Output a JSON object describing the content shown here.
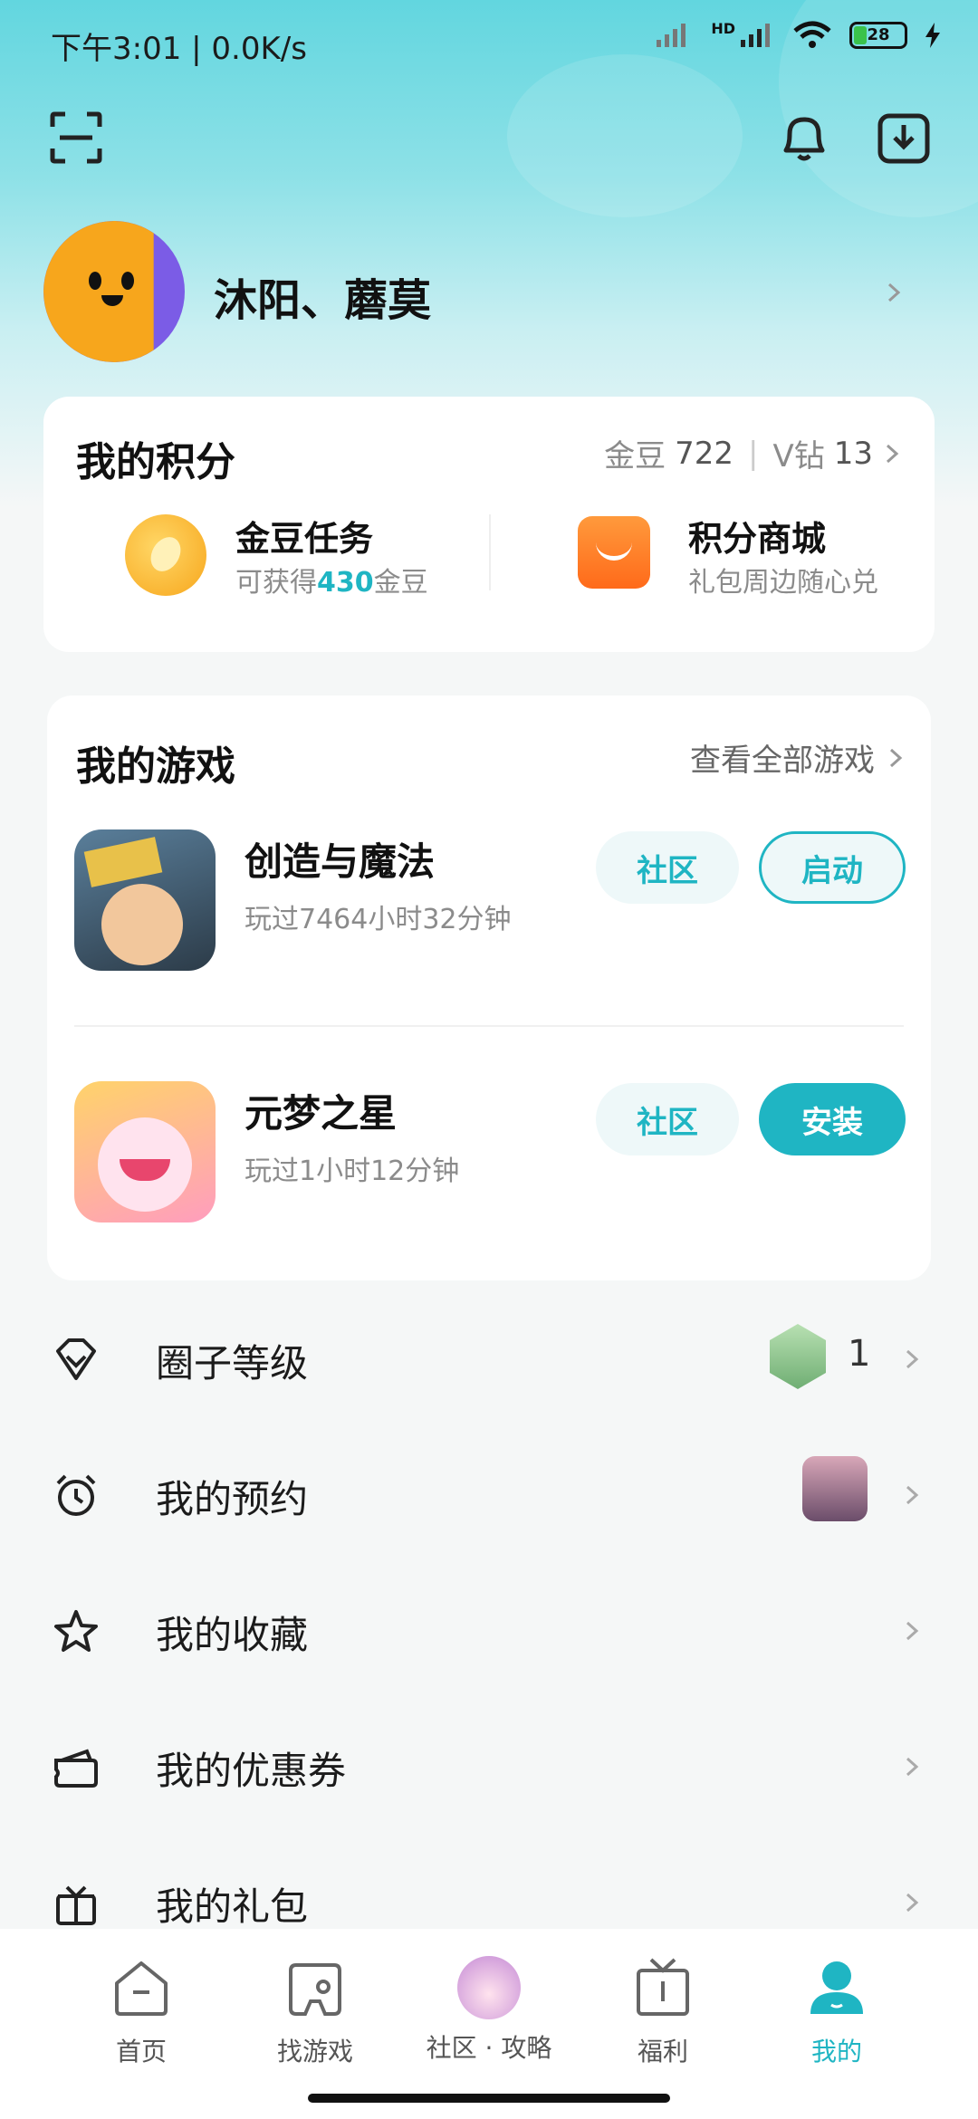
{
  "status_bar": {
    "time": "下午3:01 | 0.0K/s",
    "network_label": "HD",
    "battery": "28"
  },
  "profile": {
    "name": "沐阳、蘑莫"
  },
  "points": {
    "title": "我的积分",
    "gold_label": "金豆",
    "gold_value": "722",
    "vdiamond_label": "V钻",
    "vdiamond_value": "13",
    "gold_task": {
      "title": "金豆任务",
      "subtitle_prefix": "可获得",
      "subtitle_amount": "430",
      "subtitle_suffix": "金豆"
    },
    "mall": {
      "title": "积分商城",
      "subtitle": "礼包周边随心兑"
    }
  },
  "games": {
    "title": "我的游戏",
    "view_all": "查看全部游戏",
    "items": [
      {
        "name": "创造与魔法",
        "playtime": "玩过7464小时32分钟",
        "community": "社区",
        "action": "启动"
      },
      {
        "name": "元梦之星",
        "playtime": "玩过1小时12分钟",
        "community": "社区",
        "action": "安装"
      }
    ]
  },
  "menu": [
    {
      "label": "圈子等级",
      "value": "1",
      "icon": "shield-badge-icon"
    },
    {
      "label": "我的预约",
      "icon": "alarm-clock-icon"
    },
    {
      "label": "我的收藏",
      "icon": "star-icon"
    },
    {
      "label": "我的优惠券",
      "icon": "coupon-icon"
    },
    {
      "label": "我的礼包",
      "icon": "gift-icon"
    }
  ],
  "bottom_nav": [
    {
      "label": "首页",
      "icon": "home-icon"
    },
    {
      "label": "找游戏",
      "icon": "gamepad-icon"
    },
    {
      "label": "社区 · 攻略",
      "icon": "community-avatar-icon"
    },
    {
      "label": "福利",
      "icon": "gift-box-icon"
    },
    {
      "label": "我的",
      "icon": "user-icon",
      "active": true
    }
  ],
  "colors": {
    "accent": "#1fb5c3",
    "gold": "#f7b21c",
    "orange": "#ff7a1a"
  }
}
